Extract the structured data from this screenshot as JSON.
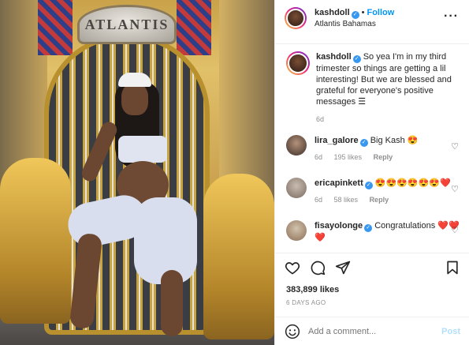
{
  "photo": {
    "sign_text": "ATLANTIS"
  },
  "header": {
    "username": "kashdoll",
    "follow_label": "Follow",
    "location": "Atlantis Bahamas",
    "more_icon": "more-horizontal-icon"
  },
  "caption": {
    "username": "kashdoll",
    "text": "So yea I'm in my third trimester so things are getting a lil interesting! But we are blessed and grateful for everyone's positive messages ☰",
    "time": "6d"
  },
  "comments": [
    {
      "username": "lira_galore",
      "text": "Big Kash 😍",
      "time": "6d",
      "likes": "195 likes",
      "reply": "Reply"
    },
    {
      "username": "ericapinkett",
      "text": "😍😍😍😍😍😍❤️",
      "time": "6d",
      "likes": "58 likes",
      "reply": "Reply"
    },
    {
      "username": "fisayolonge",
      "text": "Congratulations ❤️❤️❤️"
    }
  ],
  "actions": {
    "likes": "383,899 likes",
    "date": "6 DAYS AGO"
  },
  "add_comment": {
    "placeholder": "Add a comment...",
    "post_label": "Post"
  },
  "colors": {
    "link_blue": "#0095f6",
    "verified_blue": "#3897f0",
    "muted": "#8e8e8e",
    "post_disabled": "#b2dffc"
  }
}
